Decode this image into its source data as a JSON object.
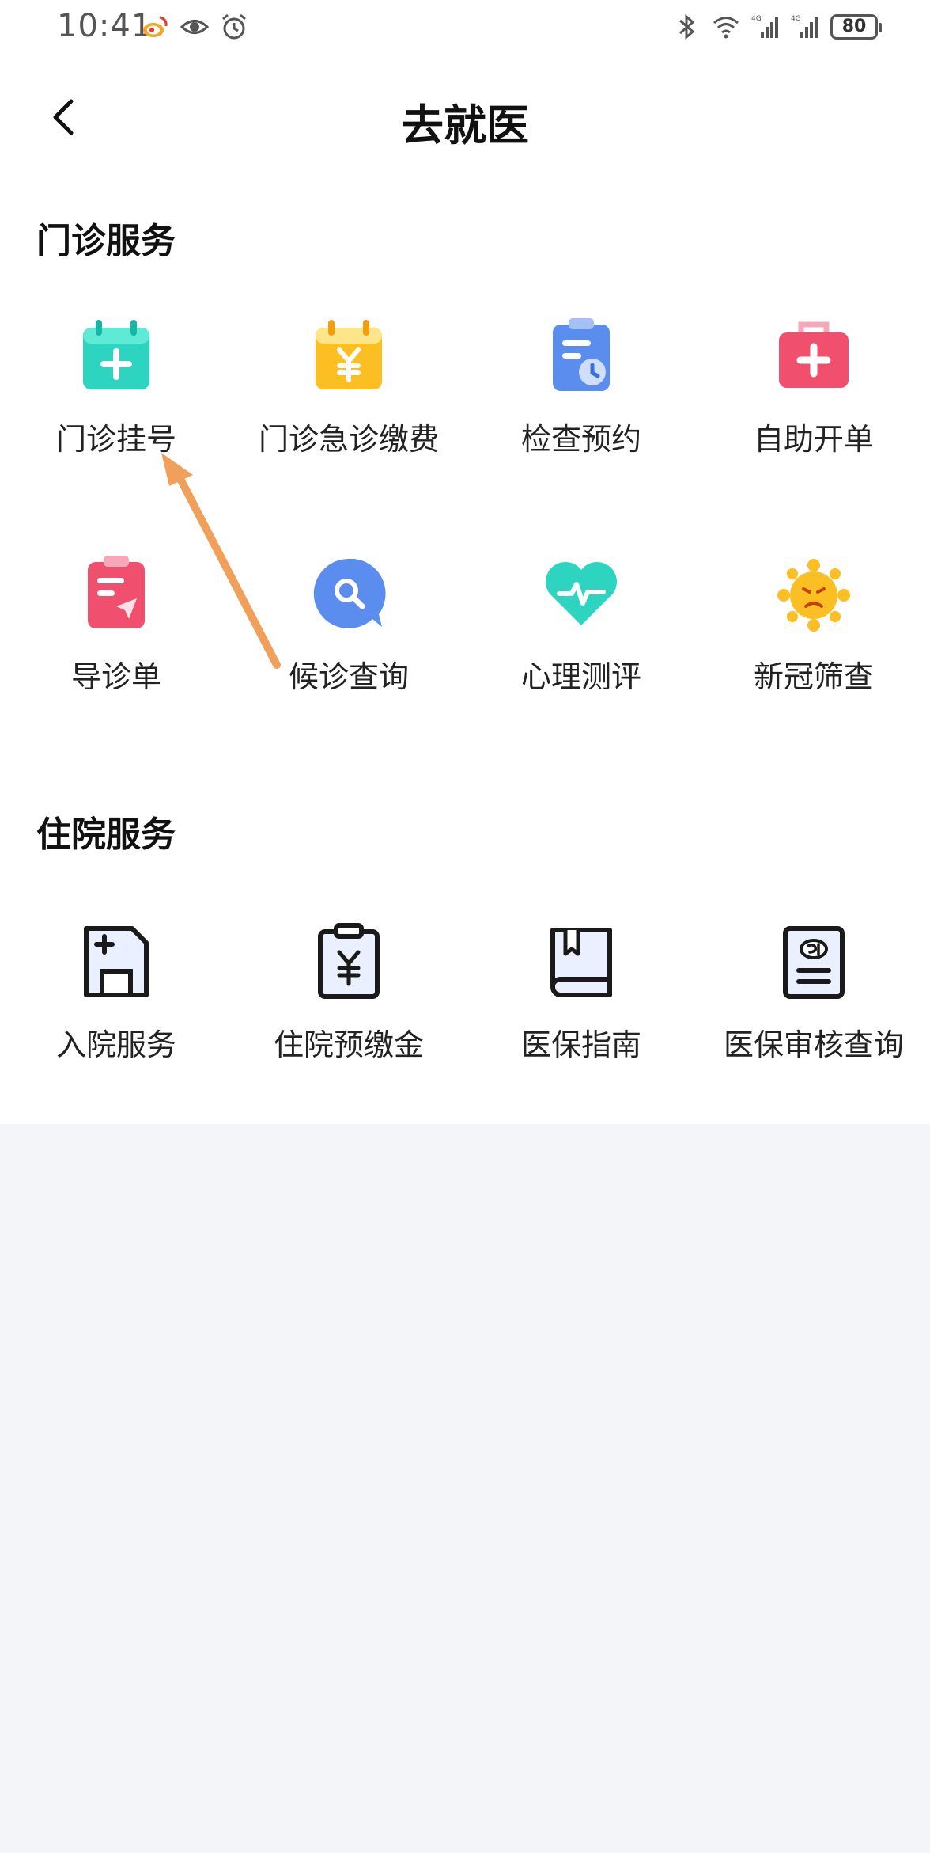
{
  "status_bar": {
    "time": "10:41",
    "battery": "80",
    "left_icons": [
      "weibo-icon",
      "eye-icon",
      "alarm-icon"
    ],
    "right_icons": [
      "bluetooth-icon",
      "wifi-icon",
      "signal-4g-icon",
      "signal-4g-icon"
    ]
  },
  "header": {
    "title": "去就医"
  },
  "outpatient": {
    "title": "门诊服务",
    "items": [
      {
        "label": "门诊挂号",
        "icon": "calendar-plus-icon"
      },
      {
        "label": "门诊急诊缴费",
        "icon": "calendar-yuan-icon"
      },
      {
        "label": "检查预约",
        "icon": "clipboard-clock-icon"
      },
      {
        "label": "自助开单",
        "icon": "medical-kit-icon"
      },
      {
        "label": "导诊单",
        "icon": "clipboard-send-icon"
      },
      {
        "label": "候诊查询",
        "icon": "search-bubble-icon"
      },
      {
        "label": "心理测评",
        "icon": "heart-pulse-icon"
      },
      {
        "label": "新冠筛查",
        "icon": "virus-icon"
      }
    ]
  },
  "inpatient": {
    "title": "住院服务",
    "items": [
      {
        "label": "入院服务",
        "icon": "admission-card-icon"
      },
      {
        "label": "住院预缴金",
        "icon": "clipboard-yuan-icon"
      },
      {
        "label": "医保指南",
        "icon": "guide-book-icon"
      },
      {
        "label": "医保审核查询",
        "icon": "insurance-card-icon"
      }
    ]
  },
  "colors": {
    "accent_teal": "#2dd4bf",
    "accent_yellow": "#fbbf24",
    "accent_blue": "#5b8def",
    "accent_red": "#f0506e",
    "annotation_arrow": "#f0a05a"
  }
}
